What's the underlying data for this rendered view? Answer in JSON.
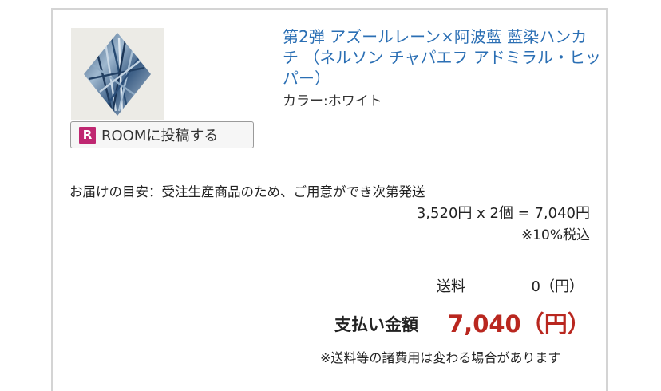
{
  "product": {
    "title": "第2弾 アズールレーン×阿波藍 藍染ハンカチ （ネルソン チャパエフ アドミラル・ヒッパー）",
    "color": "カラー:ホワイト",
    "image_icon": "indigo-diamond-handkerchief"
  },
  "room_button": {
    "logo": "R",
    "label": "ROOMに投稿する",
    "brand_color": "#bf2771"
  },
  "delivery": {
    "text": "お届けの目安：受注生産商品のため、ご用意ができ次第発送"
  },
  "pricing": {
    "line": "3,520円 x 2個 = 7,040円",
    "tax_note": "※10%税込"
  },
  "summary": {
    "shipping_label": "送料",
    "shipping_value": "0（円）",
    "total_label": "支払い金額",
    "total_value": "7,040（円）",
    "total_color": "#b9271f",
    "fee_note": "※送料等の諸費用は変わる場合があります"
  },
  "colors": {
    "link": "#2b6fb4",
    "border": "#d4d4d4"
  }
}
